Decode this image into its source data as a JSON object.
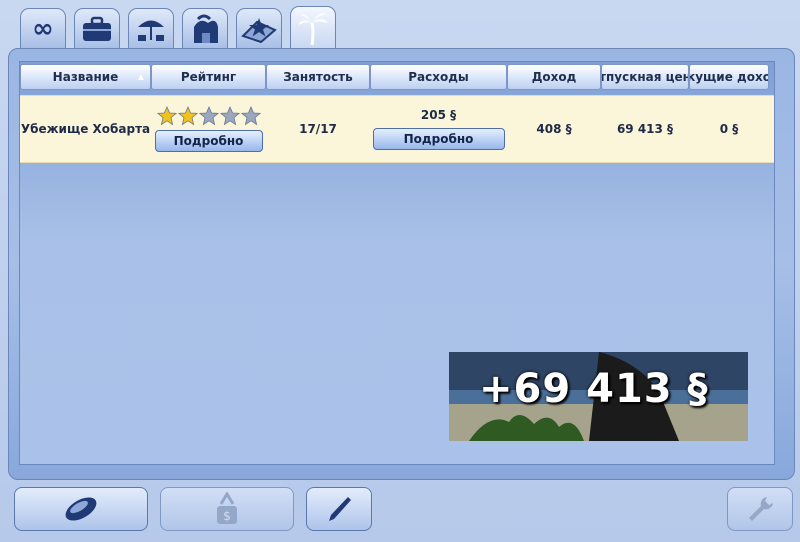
{
  "tabs": [
    {
      "name": "infinity-icon"
    },
    {
      "name": "briefcase-icon"
    },
    {
      "name": "beach-umbrella-icon"
    },
    {
      "name": "resort-icon"
    },
    {
      "name": "star-map-icon"
    },
    {
      "name": "palm-tree-icon"
    }
  ],
  "table": {
    "headers": {
      "name": "Название",
      "rating": "Рейтинг",
      "occupancy": "Занятость",
      "expenses": "Расходы",
      "income": "Доход",
      "purchase_price": "тпускная цен",
      "current_income": "кущие дохо"
    },
    "row": {
      "name": "Убежище Хобарта",
      "rating_stars_filled": 2,
      "rating_stars_total": 5,
      "rating_button": "Подробно",
      "occupancy": "17/17",
      "expenses": "205 §",
      "expenses_button": "Подробно",
      "income": "408 §",
      "purchase_price": "69 413 §",
      "current_income": "0 §"
    }
  },
  "popup": {
    "amount": "+69 413 §"
  },
  "bottom_buttons": [
    {
      "name": "sell-button",
      "icon": "coin-icon",
      "enabled": true
    },
    {
      "name": "buy-button",
      "icon": "money-bag-icon",
      "enabled": false
    },
    {
      "name": "edit-button",
      "icon": "pen-icon",
      "enabled": true
    },
    {
      "name": "settings-button",
      "icon": "wrench-icon",
      "enabled": false
    }
  ],
  "colors": {
    "gold_star": "#f1c21b",
    "grey_star": "#9aa7bd",
    "row_bg": "#fbf6d9",
    "accent": "#1e3e7b"
  }
}
